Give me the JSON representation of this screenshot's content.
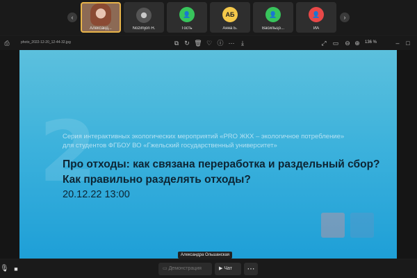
{
  "participants": [
    {
      "name": "Александ...",
      "type": "photo",
      "active": true
    },
    {
      "name": "Nozimjon H.",
      "type": "photo2",
      "active": false
    },
    {
      "name": "Гость",
      "type": "avatar",
      "color": "#38c45c",
      "initials": ""
    },
    {
      "name": "Анна Б.",
      "type": "avatar",
      "color": "#f4c84a",
      "initials": "АБ"
    },
    {
      "name": "Васильцо...",
      "type": "avatar",
      "color": "#38c45c",
      "initials": ""
    },
    {
      "name": "ИА",
      "type": "avatar",
      "color": "#e84848",
      "initials": ""
    }
  ],
  "viewer": {
    "filename": "photo_2022-12-20_12-44-32.jpg",
    "zoom": "136 %"
  },
  "slide": {
    "number": "2",
    "series_line1": "Серия интерактивных экологических мероприятий «PRO ЖКХ – экологичное потребление»",
    "series_line2": "для студентов ФГБОУ ВО «Гжельский государственный университет»",
    "title_line1": "Про отходы: как связана переработка и раздельный сбор?",
    "title_line2": "Как правильно разделять отходы?",
    "date": "20.12.22 13:00"
  },
  "speaker_label": "Александра Ольшанская",
  "controls": {
    "demo_label": "Демонстрация",
    "chat_label": "Чат",
    "more_label": "⋯"
  },
  "colors": {
    "accent": "#e8b44a",
    "slide_top": "#5cc0dd",
    "slide_bottom": "#1e9fd7"
  }
}
